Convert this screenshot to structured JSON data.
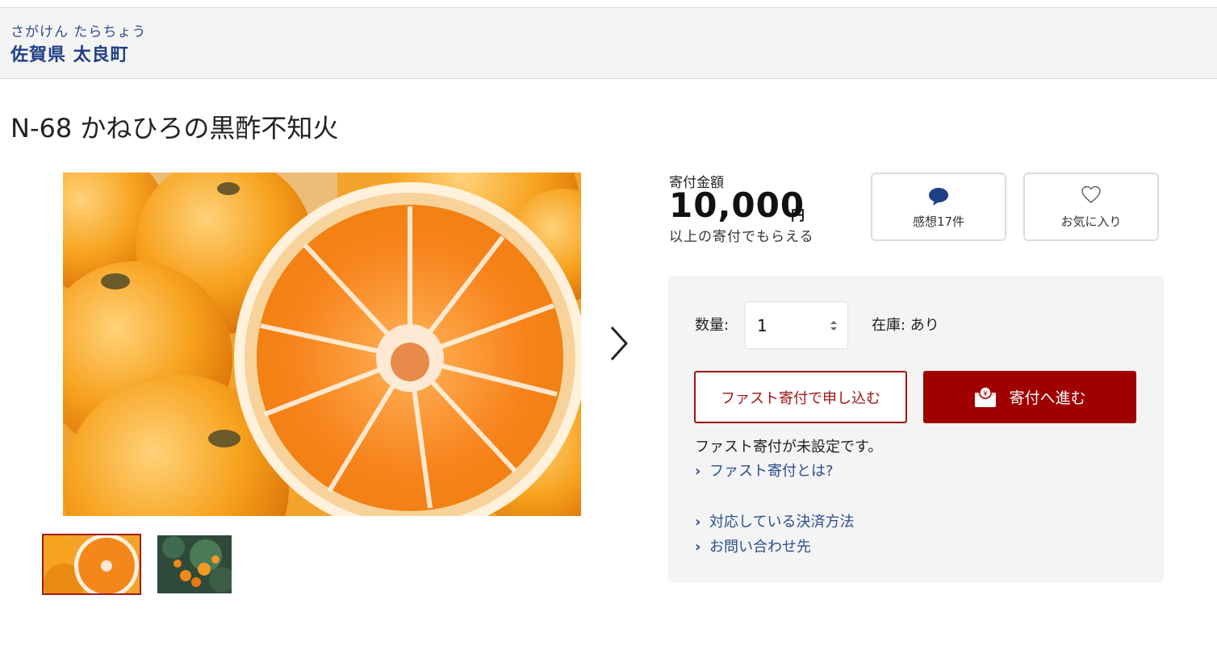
{
  "municipality": {
    "kana": "さがけん たらちょう",
    "name": "佐賀県 太良町"
  },
  "product": {
    "title": "N-68 かねひろの黒酢不知火"
  },
  "gallery": {
    "main_image": "orange-fruit-photo",
    "thumbnails": [
      {
        "image": "orange-halves-thumb",
        "selected": true
      },
      {
        "image": "orange-tree-thumb",
        "selected": false
      }
    ]
  },
  "price": {
    "label": "寄付金額",
    "amount": "10,000",
    "unit": "円",
    "note": "以上の寄付でもらえる"
  },
  "actions": {
    "reviews_label": "感想17件",
    "favorite_label": "お気に入り"
  },
  "order": {
    "quantity_label": "数量:",
    "quantity_value": "1",
    "stock_text": "在庫: あり",
    "fast_button": "ファスト寄付で申し込む",
    "proceed_button": "寄付へ進む",
    "fast_status": "ファスト寄付が未設定です。",
    "links": [
      "ファスト寄付とは?",
      "対応している決済方法",
      "お問い合わせ先"
    ]
  },
  "colors": {
    "accent_red": "#a10000",
    "link_blue": "#2a4f8f",
    "panel_bg": "#f4f4f4"
  }
}
